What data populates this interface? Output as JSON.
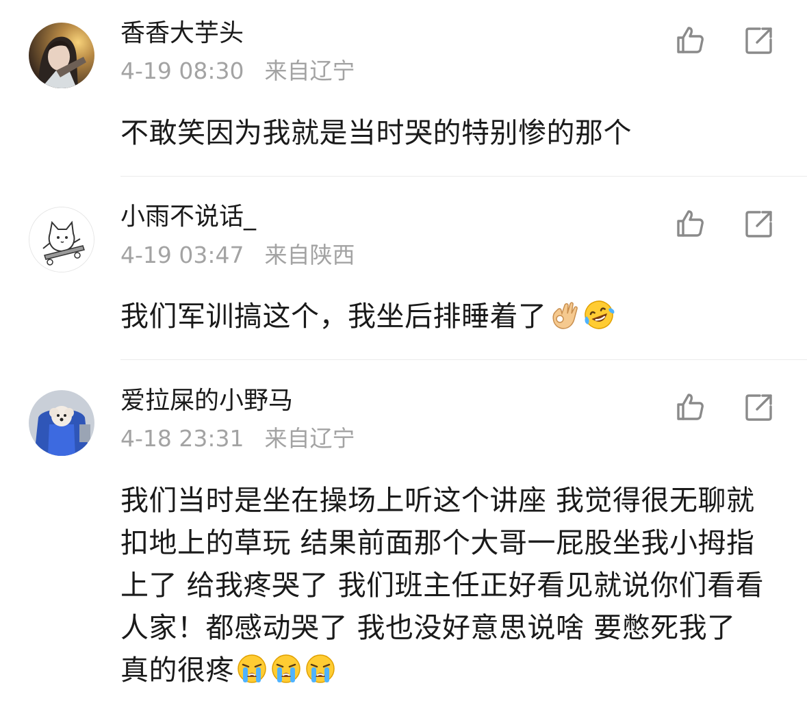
{
  "comments": [
    {
      "username": "香香大芋头",
      "time": "4-19 08:30",
      "location": "来自辽宁",
      "text": "不敢笑因为我就是当时哭的特别惨的那个",
      "emojis": []
    },
    {
      "username": "小雨不说话_",
      "time": "4-19 03:47",
      "location": "来自陕西",
      "text": "我们军训搞这个，我坐后排睡着了",
      "emojis": [
        "ok-hand-emoji",
        "laughing-crying-emoji"
      ]
    },
    {
      "username": "爱拉屎的小野马",
      "time": "4-18 23:31",
      "location": "来自辽宁",
      "text": "我们当时是坐在操场上听这个讲座 我觉得很无聊就扣地上的草玩 结果前面那个大哥一屁股坐我小拇指上了 给我疼哭了 我们班主任正好看见就说你们看看人家！都感动哭了 我也没好意思说啥 要憋死我了 真的很疼",
      "emojis": [
        "loudly-crying-emoji",
        "loudly-crying-emoji",
        "loudly-crying-emoji"
      ]
    }
  ],
  "icons": {
    "like": "thumbs-up-outline-icon",
    "share": "share-outline-icon"
  },
  "colors": {
    "text": "#1a1a1a",
    "meta": "#a3a3a3",
    "icon": "#8a8a8a",
    "divider": "#ebebeb"
  }
}
